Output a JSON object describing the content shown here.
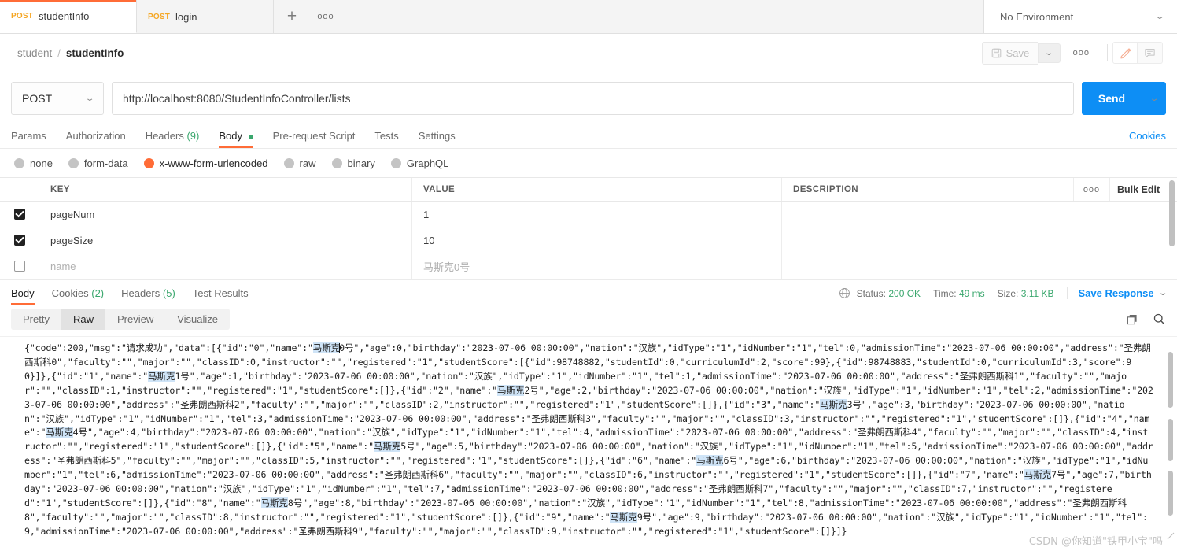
{
  "tabs": [
    {
      "method": "POST",
      "name": "studentInfo",
      "active": true
    },
    {
      "method": "POST",
      "name": "login",
      "active": false
    }
  ],
  "tabstrip": {
    "new_tab": "+",
    "more": "ooo",
    "environment": "No Environment"
  },
  "breadcrumb": {
    "parent": "student",
    "separator": "/",
    "current": "studentInfo",
    "save_label": "Save",
    "more": "ooo"
  },
  "request": {
    "method": "POST",
    "url": "http://localhost:8080/StudentInfoController/lists",
    "send_label": "Send",
    "tabs": [
      {
        "label": "Params",
        "count": "",
        "active": false,
        "dot": false
      },
      {
        "label": "Authorization",
        "count": "",
        "active": false,
        "dot": false
      },
      {
        "label": "Headers",
        "count": "(9)",
        "active": false,
        "dot": false
      },
      {
        "label": "Body",
        "count": "",
        "active": true,
        "dot": true
      },
      {
        "label": "Pre-request Script",
        "count": "",
        "active": false,
        "dot": false
      },
      {
        "label": "Tests",
        "count": "",
        "active": false,
        "dot": false
      },
      {
        "label": "Settings",
        "count": "",
        "active": false,
        "dot": false
      }
    ],
    "cookies_link": "Cookies",
    "body_types": [
      {
        "label": "none",
        "selected": false
      },
      {
        "label": "form-data",
        "selected": false
      },
      {
        "label": "x-www-form-urlencoded",
        "selected": true
      },
      {
        "label": "raw",
        "selected": false
      },
      {
        "label": "binary",
        "selected": false
      },
      {
        "label": "GraphQL",
        "selected": false
      }
    ]
  },
  "params_table": {
    "headers": {
      "key": "KEY",
      "value": "VALUE",
      "description": "DESCRIPTION",
      "actions": "ooo",
      "bulk_edit": "Bulk Edit"
    },
    "rows": [
      {
        "checked": true,
        "key": "pageNum",
        "value": "1",
        "description": "",
        "placeholder": false
      },
      {
        "checked": true,
        "key": "pageSize",
        "value": "10",
        "description": "",
        "placeholder": false
      },
      {
        "checked": false,
        "key": "name",
        "value": "马斯克0号",
        "description": "",
        "placeholder": true
      }
    ]
  },
  "response": {
    "tabs": [
      {
        "label": "Body",
        "count": "",
        "active": true
      },
      {
        "label": "Cookies",
        "count": "(2)",
        "active": false
      },
      {
        "label": "Headers",
        "count": "(5)",
        "active": false
      },
      {
        "label": "Test Results",
        "count": "",
        "active": false
      }
    ],
    "status_label": "Status:",
    "status_value": "200 OK",
    "time_label": "Time:",
    "time_value": "49 ms",
    "size_label": "Size:",
    "size_value": "3.11 KB",
    "save_response": "Save Response",
    "view_modes": [
      {
        "label": "Pretty",
        "active": false
      },
      {
        "label": "Raw",
        "active": true
      },
      {
        "label": "Preview",
        "active": false
      },
      {
        "label": "Visualize",
        "active": false
      }
    ],
    "body_segments": [
      {
        "t": "{\"code\":200,\"msg\":\"请求成功\",\"data\":[{\"id\":\"0\",\"name\":\""
      },
      {
        "t": "马斯克",
        "hl": true
      },
      {
        "caret": true
      },
      {
        "t": "0号\",\"age\":0,\"birthday\":\"2023-07-06 00:00:00\",\"nation\":\"汉族\",\"idType\":\"1\",\"idNumber\":\"1\",\"tel\":0,\"admissionTime\":\"2023-07-06 00:00:00\",\"address\":\"圣弗朗西斯科0\",\"faculty\":\"\",\"major\":\"\",\"classID\":0,\"instructor\":\"\",\"registered\":\"1\",\"studentScore\":[{\"id\":98748882,\"studentId\":0,\"curriculumId\":2,\"score\":99},{\"id\":98748883,\"studentId\":0,\"curriculumId\":3,\"score\":90}]},{\"id\":\"1\",\"name\":\""
      },
      {
        "t": "马斯克",
        "hl": true
      },
      {
        "t": "1号\",\"age\":1,\"birthday\":\"2023-07-06 00:00:00\",\"nation\":\"汉族\",\"idType\":\"1\",\"idNumber\":\"1\",\"tel\":1,\"admissionTime\":\"2023-07-06 00:00:00\",\"address\":\"圣弗朗西斯科1\",\"faculty\":\"\",\"major\":\"\",\"classID\":1,\"instructor\":\"\",\"registered\":\"1\",\"studentScore\":[]},{\"id\":\"2\",\"name\":\""
      },
      {
        "t": "马斯克",
        "hl": true
      },
      {
        "t": "2号\",\"age\":2,\"birthday\":\"2023-07-06 00:00:00\",\"nation\":\"汉族\",\"idType\":\"1\",\"idNumber\":\"1\",\"tel\":2,\"admissionTime\":\"2023-07-06 00:00:00\",\"address\":\"圣弗朗西斯科2\",\"faculty\":\"\",\"major\":\"\",\"classID\":2,\"instructor\":\"\",\"registered\":\"1\",\"studentScore\":[]},{\"id\":\"3\",\"name\":\""
      },
      {
        "t": "马斯克",
        "hl": true
      },
      {
        "t": "3号\",\"age\":3,\"birthday\":\"2023-07-06 00:00:00\",\"nation\":\"汉族\",\"idType\":\"1\",\"idNumber\":\"1\",\"tel\":3,\"admissionTime\":\"2023-07-06 00:00:00\",\"address\":\"圣弗朗西斯科3\",\"faculty\":\"\",\"major\":\"\",\"classID\":3,\"instructor\":\"\",\"registered\":\"1\",\"studentScore\":[]},{\"id\":\"4\",\"name\":\""
      },
      {
        "t": "马斯克",
        "hl": true
      },
      {
        "t": "4号\",\"age\":4,\"birthday\":\"2023-07-06 00:00:00\",\"nation\":\"汉族\",\"idType\":\"1\",\"idNumber\":\"1\",\"tel\":4,\"admissionTime\":\"2023-07-06 00:00:00\",\"address\":\"圣弗朗西斯科4\",\"faculty\":\"\",\"major\":\"\",\"classID\":4,\"instructor\":\"\",\"registered\":\"1\",\"studentScore\":[]},{\"id\":\"5\",\"name\":\""
      },
      {
        "t": "马斯克",
        "hl": true
      },
      {
        "t": "5号\",\"age\":5,\"birthday\":\"2023-07-06 00:00:00\",\"nation\":\"汉族\",\"idType\":\"1\",\"idNumber\":\"1\",\"tel\":5,\"admissionTime\":\"2023-07-06 00:00:00\",\"address\":\"圣弗朗西斯科5\",\"faculty\":\"\",\"major\":\"\",\"classID\":5,\"instructor\":\"\",\"registered\":\"1\",\"studentScore\":[]},{\"id\":\"6\",\"name\":\""
      },
      {
        "t": "马斯克",
        "hl": true
      },
      {
        "t": "6号\",\"age\":6,\"birthday\":\"2023-07-06 00:00:00\",\"nation\":\"汉族\",\"idType\":\"1\",\"idNumber\":\"1\",\"tel\":6,\"admissionTime\":\"2023-07-06 00:00:00\",\"address\":\"圣弗朗西斯科6\",\"faculty\":\"\",\"major\":\"\",\"classID\":6,\"instructor\":\"\",\"registered\":\"1\",\"studentScore\":[]},{\"id\":\"7\",\"name\":\""
      },
      {
        "t": "马斯克",
        "hl": true
      },
      {
        "t": "7号\",\"age\":7,\"birthday\":\"2023-07-06 00:00:00\",\"nation\":\"汉族\",\"idType\":\"1\",\"idNumber\":\"1\",\"tel\":7,\"admissionTime\":\"2023-07-06 00:00:00\",\"address\":\"圣弗朗西斯科7\",\"faculty\":\"\",\"major\":\"\",\"classID\":7,\"instructor\":\"\",\"registered\":\"1\",\"studentScore\":[]},{\"id\":\"8\",\"name\":\""
      },
      {
        "t": "马斯克",
        "hl": true
      },
      {
        "t": "8号\",\"age\":8,\"birthday\":\"2023-07-06 00:00:00\",\"nation\":\"汉族\",\"idType\":\"1\",\"idNumber\":\"1\",\"tel\":8,\"admissionTime\":\"2023-07-06 00:00:00\",\"address\":\"圣弗朗西斯科8\",\"faculty\":\"\",\"major\":\"\",\"classID\":8,\"instructor\":\"\",\"registered\":\"1\",\"studentScore\":[]},{\"id\":\"9\",\"name\":\""
      },
      {
        "t": "马斯克",
        "hl": true
      },
      {
        "t": "9号\",\"age\":9,\"birthday\":\"2023-07-06 00:00:00\",\"nation\":\"汉族\",\"idType\":\"1\",\"idNumber\":\"1\",\"tel\":9,\"admissionTime\":\"2023-07-06 00:00:00\",\"address\":\"圣弗朗西斯科9\",\"faculty\":\"\",\"major\":\"\",\"classID\":9,\"instructor\":\"\",\"registered\":\"1\",\"studentScore\":[]}]}"
      }
    ]
  },
  "watermark": "CSDN @你知道\"铁甲小宝\"吗",
  "colors": {
    "accent": "#ff6c37",
    "primary": "#0d8ef5",
    "success": "#3aa76d",
    "highlight": "#cfe4f7"
  }
}
